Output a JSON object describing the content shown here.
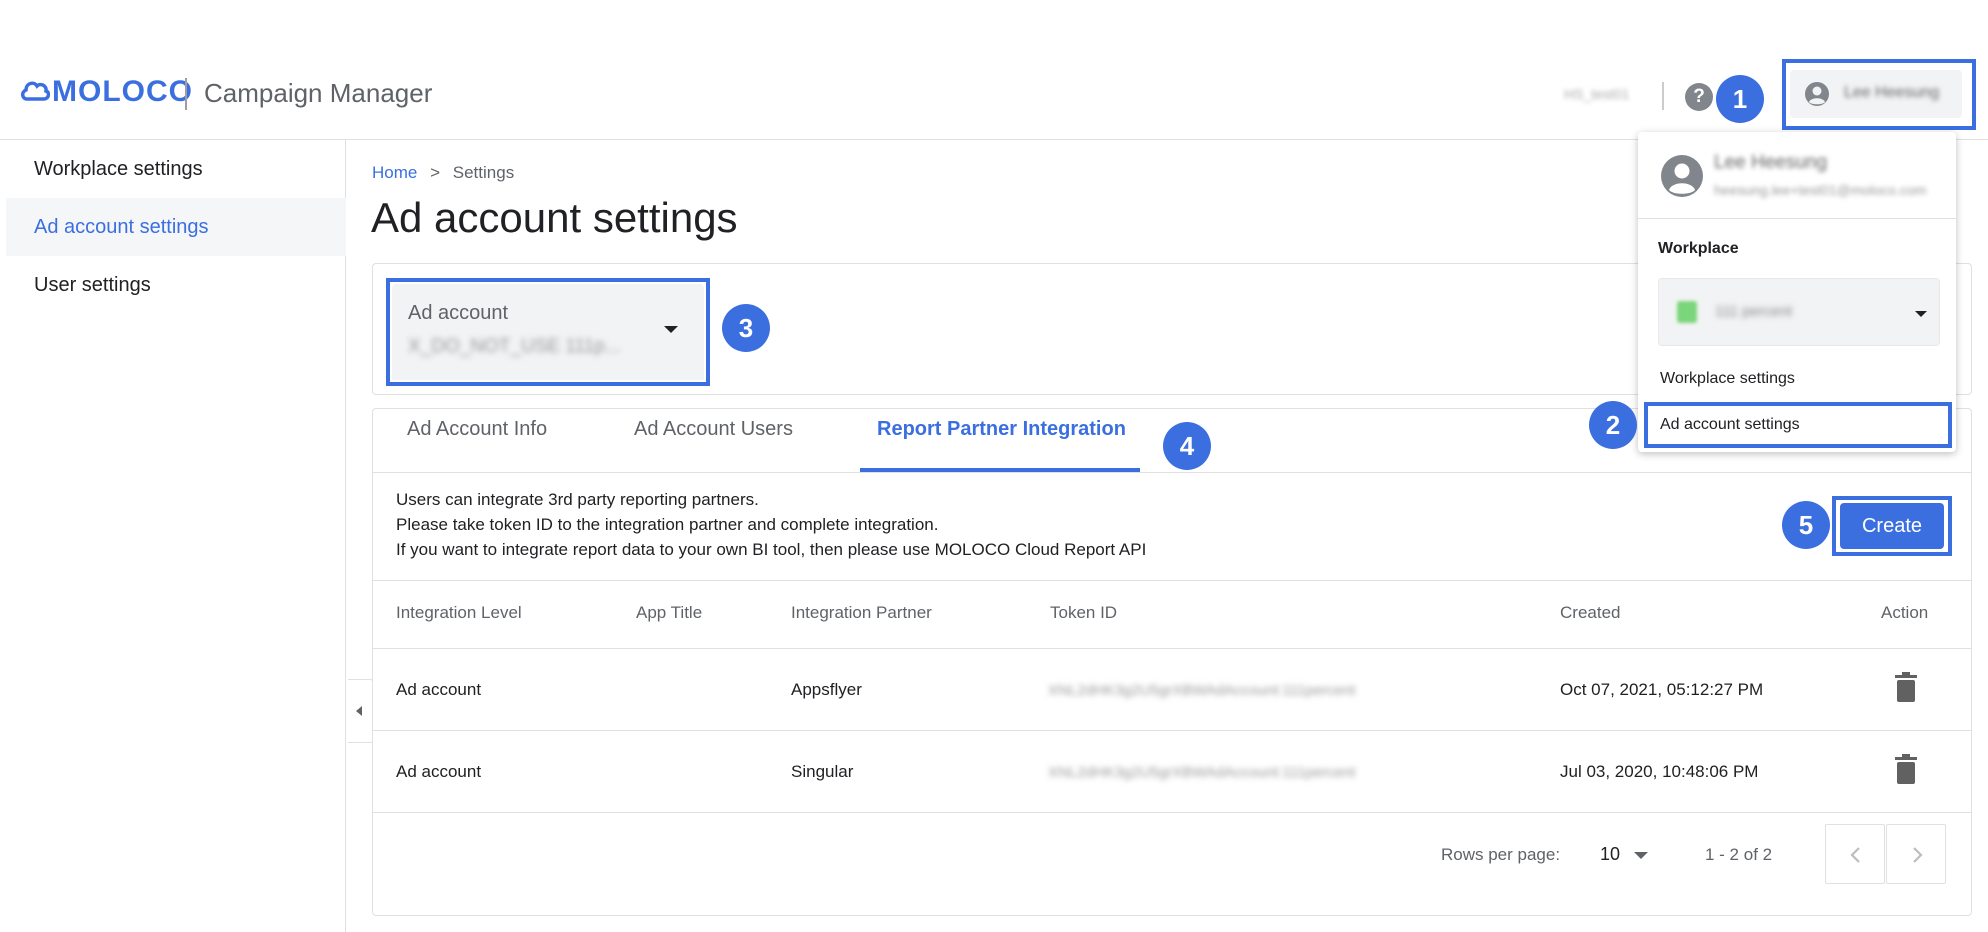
{
  "header": {
    "logo_text": "MOLOCO",
    "app_name": "Campaign Manager",
    "workplace_name": "HS_test01",
    "help_icon": "?",
    "user_name": "Lee Heesung"
  },
  "user_menu": {
    "name": "Lee Heesung",
    "email": "heesung.lee+test01@moloco.com",
    "workplace_label": "Workplace",
    "workplace_value": "111 percent",
    "workplace_settings": "Workplace settings",
    "ad_account_settings": "Ad account settings"
  },
  "badges": [
    "1",
    "2",
    "3",
    "4",
    "5"
  ],
  "sidebar": {
    "items": [
      {
        "label": "Workplace settings"
      },
      {
        "label": "Ad account settings"
      },
      {
        "label": "User settings"
      }
    ]
  },
  "breadcrumb": {
    "home": "Home",
    "sep": ">",
    "current": "Settings"
  },
  "page_title": "Ad account settings",
  "ad_account_select": {
    "label": "Ad account",
    "value": "X_DO_NOT_USE 111p..."
  },
  "tabs": [
    {
      "label": "Ad Account Info"
    },
    {
      "label": "Ad Account Users"
    },
    {
      "label": "Report Partner Integration"
    }
  ],
  "info_lines": [
    "Users can integrate 3rd party reporting partners.",
    "Please take token ID to the integration partner and complete integration.",
    "If you want to integrate report data to your own BI tool, then please use MOLOCO Cloud Report API"
  ],
  "create_button": "Create",
  "table": {
    "columns": [
      "Integration Level",
      "App Title",
      "Integration Partner",
      "Token ID",
      "Created",
      "Action"
    ],
    "rows": [
      {
        "level": "Ad account",
        "app": "",
        "partner": "Appsflyer",
        "token": "XNL2dHK3g2U5grXBWAdAccount:111percent",
        "created": "Oct 07, 2021, 05:12:27 PM"
      },
      {
        "level": "Ad account",
        "app": "",
        "partner": "Singular",
        "token": "XNL2dHK3g2U5grXBWAdAccount:111percent",
        "created": "Jul 03, 2020, 10:48:06 PM"
      }
    ]
  },
  "pagination": {
    "rows_label": "Rows per page:",
    "rows_value": "10",
    "range": "1 - 2 of 2"
  },
  "colors": {
    "accent": "#3b6fe0",
    "text": "#202124",
    "muted": "#5f6368",
    "border": "#e0e0e0"
  },
  "icons": [
    "cloud-logo-icon",
    "help-icon",
    "account-circle-icon",
    "chevron-down-icon",
    "trash-icon",
    "chevron-left-icon",
    "chevron-right-icon",
    "collapse-left-icon"
  ]
}
